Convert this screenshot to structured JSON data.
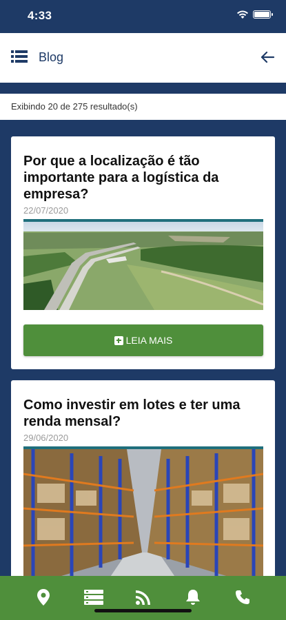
{
  "status_bar": {
    "time": "4:33"
  },
  "header": {
    "title": "Blog"
  },
  "results": {
    "summary": "Exibindo 20 de 275 resultado(s)"
  },
  "posts": [
    {
      "title": "Por que a localização é tão importante para a logística da empresa?",
      "date": "22/07/2020",
      "image": "aerial-highway-landscape",
      "button_label": "LEIA MAIS"
    },
    {
      "title": "Como investir em lotes e ter uma renda mensal?",
      "date": "29/06/2020",
      "image": "warehouse-shelves"
    }
  ],
  "bottom_nav": {
    "items": [
      "location-pin-icon",
      "list-icon",
      "rss-icon",
      "bell-icon",
      "phone-icon"
    ]
  },
  "colors": {
    "primary": "#1e3a66",
    "accent_green": "#4f8f3b",
    "image_border": "#1f6f7c"
  }
}
